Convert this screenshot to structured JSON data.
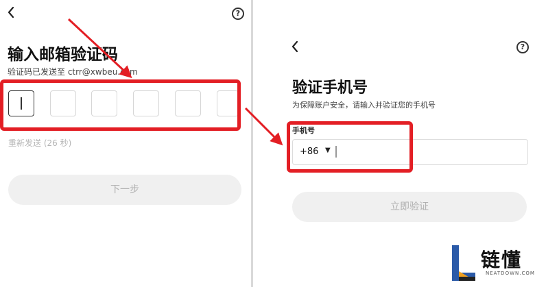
{
  "email_step": {
    "back_icon": "chevron-left-icon",
    "help_icon": "question-circle-icon",
    "help_glyph": "?",
    "title": "输入邮箱验证码",
    "sent_to_text": "验证码已发送至 ctrr@xwbeu.com",
    "code_digits": [
      "",
      "",
      "",
      "",
      "",
      ""
    ],
    "resend_text": "重新发送 (26 秒)",
    "next_button": "下一步"
  },
  "phone_step": {
    "back_icon": "chevron-left-icon",
    "help_icon": "question-circle-icon",
    "help_glyph": "?",
    "title": "验证手机号",
    "subtitle": "为保障账户安全，请输入并验证您的手机号",
    "phone_label": "手机号",
    "country_code": "+86",
    "phone_value": "",
    "verify_button": "立即验证"
  },
  "annotations": {
    "highlight_color": "#e31e24"
  },
  "watermark": {
    "title": "链懂",
    "subtitle": "NEATDOWN.COM"
  }
}
